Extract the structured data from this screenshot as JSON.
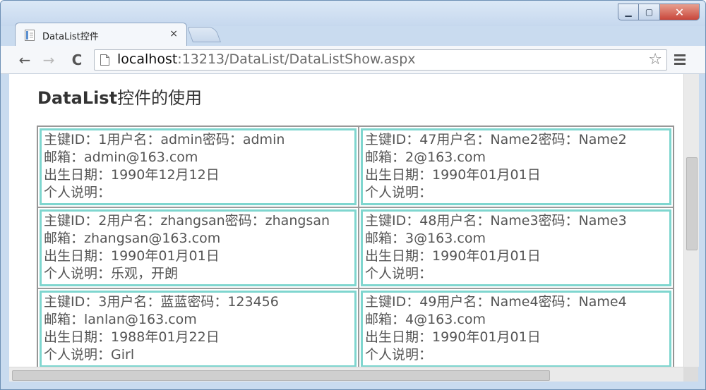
{
  "browser": {
    "tab_title": "DataList控件",
    "tab_close": "×",
    "url_host": "localhost",
    "url_rest": ":13213/DataList/DataListShow.aspx",
    "window_controls": {
      "minimize": "▁",
      "maximize": "▢",
      "close": "✕"
    },
    "nav": {
      "back": "←",
      "forward": "→",
      "reload": "C"
    },
    "bookmark_star": "☆"
  },
  "page": {
    "title_bold": "DataList",
    "title_rest": "控件的使用"
  },
  "records": [
    {
      "line1": "主键ID：1用户名：admin密码：admin",
      "line2": "邮箱：admin@163.com",
      "line3": "出生日期：1990年12月12日",
      "line4": "个人说明："
    },
    {
      "line1": "主键ID：47用户名：Name2密码：Name2",
      "line2": "邮箱：2@163.com",
      "line3": "出生日期：1990年01月01日",
      "line4": "个人说明："
    },
    {
      "line1": "主键ID：2用户名：zhangsan密码：zhangsan",
      "line2": "邮箱：zhangsan@163.com",
      "line3": "出生日期：1990年01月01日",
      "line4": "个人说明：乐观，开朗"
    },
    {
      "line1": "主键ID：48用户名：Name3密码：Name3",
      "line2": "邮箱：3@163.com",
      "line3": "出生日期：1990年01月01日",
      "line4": "个人说明："
    },
    {
      "line1": "主键ID：3用户名：蓝蓝密码：123456",
      "line2": "邮箱：lanlan@163.com",
      "line3": "出生日期：1988年01月22日",
      "line4": "个人说明：Girl"
    },
    {
      "line1": "主键ID：49用户名：Name4密码：Name4",
      "line2": "邮箱：4@163.com",
      "line3": "出生日期：1990年01月01日",
      "line4": "个人说明："
    }
  ]
}
